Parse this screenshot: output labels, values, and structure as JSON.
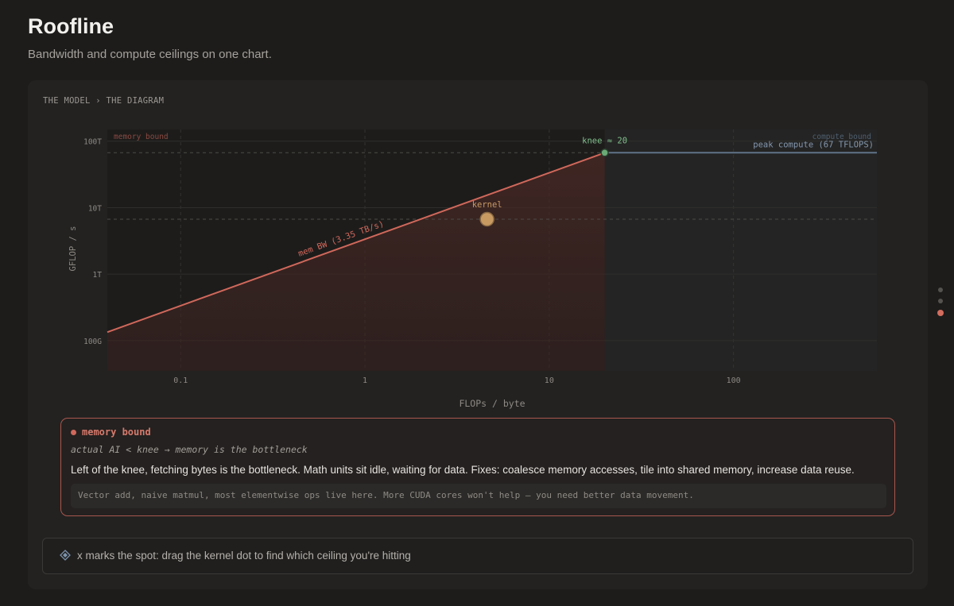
{
  "page": {
    "title": "Roofline",
    "subtitle": "Bandwidth and compute ceilings on one chart."
  },
  "breadcrumb": "THE MODEL › THE DIAGRAM",
  "chart_data": {
    "type": "line",
    "xlabel": "FLOPs / byte",
    "ylabel": "GFLOP / s",
    "x_scale": "log",
    "y_scale": "log",
    "xlim": [
      0.04,
      600
    ],
    "ylim": [
      35,
      150000
    ],
    "x_ticks": [
      {
        "value": 0.1,
        "label": "0.1"
      },
      {
        "value": 1,
        "label": "1"
      },
      {
        "value": 10,
        "label": "10"
      },
      {
        "value": 100,
        "label": "100"
      }
    ],
    "y_ticks": [
      {
        "value": 100,
        "label": "100G"
      },
      {
        "value": 1000,
        "label": "1T"
      },
      {
        "value": 10000,
        "label": "10T"
      },
      {
        "value": 100000,
        "label": "100T"
      }
    ],
    "series": [
      {
        "name": "mem BW (3.35 TB/s)",
        "color": "#d0685b",
        "points": [
          [
            0.04,
            134
          ],
          [
            20,
            67000
          ]
        ]
      },
      {
        "name": "peak compute (67 TFLOPS)",
        "color": "#5f7388",
        "points": [
          [
            20,
            67000
          ],
          [
            600,
            67000
          ]
        ]
      }
    ],
    "ref_levels": [
      67000,
      6700
    ],
    "knee": {
      "x": 20,
      "y": 67000,
      "label": "knee ≈ 20",
      "color": "#6aaa75"
    },
    "kernel": {
      "x": 4.6,
      "y": 6700,
      "label": "kernel",
      "color": "#c89a62"
    },
    "regions": {
      "left": "memory bound",
      "right": "compute bound"
    },
    "grid": true
  },
  "regime": {
    "title": "memory bound",
    "condition": "actual AI < knee → memory is the bottleneck",
    "description": "Left of the knee, fetching bytes is the bottleneck. Math units sit idle, waiting for data. Fixes: coalesce memory accesses, tile into shared memory, increase data reuse.",
    "examples": "Vector add, naive matmul, most elementwise ops live here. More CUDA cores won't help — you need better data movement."
  },
  "hint": {
    "icon": "diamond-icon",
    "text": "x marks the spot: drag the kernel dot to find which ceiling you're hitting"
  },
  "side_nav": {
    "count": 3,
    "active": 2
  }
}
